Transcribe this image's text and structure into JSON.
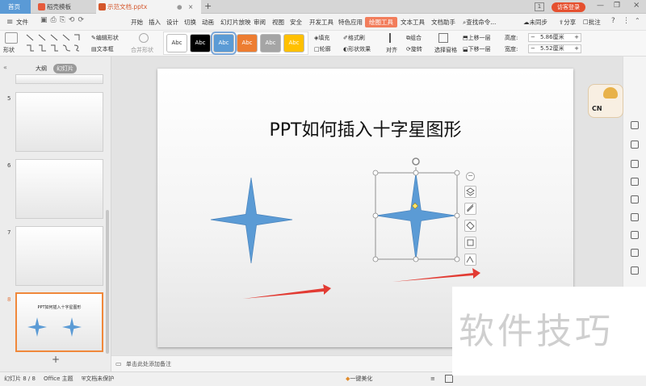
{
  "tabs": [
    {
      "label": "首页"
    },
    {
      "label": "稻壳模板"
    },
    {
      "label": "示范文档.pptx"
    }
  ],
  "title_right": {
    "login": "访客登录",
    "page_badge": "1"
  },
  "menu": {
    "file": "文件",
    "items": [
      "开始",
      "插入",
      "设计",
      "切换",
      "动画",
      "幻灯片放映",
      "审阅",
      "视图",
      "安全",
      "开发工具",
      "特色应用",
      "绘图工具",
      "文本工具",
      "文档助手"
    ],
    "active": "绘图工具",
    "search": "查找命令...",
    "sync": "未同步",
    "share": "分享",
    "comment": "批注"
  },
  "ribbon": {
    "shape": "形状",
    "edit_shape": "编辑形状",
    "textbox": "文本框",
    "merge_shape": "合并形状",
    "styles": [
      "Abc",
      "Abc",
      "Abc",
      "Abc",
      "Abc",
      "Abc"
    ],
    "style_colors": [
      "#ffffff",
      "#000000",
      "#5b9bd5",
      "#ed7d31",
      "#a5a5a5",
      "#ffc000"
    ],
    "fill": "填充",
    "format_brush": "格式刷",
    "outline": "轮廓",
    "shape_effect": "形状效果",
    "align": "对齐",
    "group": "组合",
    "rotate": "旋转",
    "select_pane": "选择窗格",
    "bring_forward": "上移一层",
    "send_backward": "下移一层",
    "height_label": "高度:",
    "height_value": "5.86厘米",
    "width_label": "宽度:",
    "width_value": "5.52厘米"
  },
  "panel": {
    "tab_outline": "大纲",
    "tab_slides": "幻灯片",
    "slide_numbers": [
      "5",
      "6",
      "7",
      "8"
    ],
    "thumb_title": "PPT如何插入十字星图形",
    "add": "+"
  },
  "slide": {
    "title": "PPT如何插入十字星图形"
  },
  "notes": {
    "placeholder": "单击此处添加备注"
  },
  "status": {
    "slide_count": "幻灯片 8 / 8",
    "theme": "Office 主题",
    "protect": "文档未保护",
    "beautify": "一键美化"
  },
  "watermark": {
    "text": "软件技巧"
  },
  "mascot": {
    "text": "CN"
  },
  "colors": {
    "star": "#5b9bd5",
    "arrow": "#e23b33",
    "accent": "#f27d5b",
    "selection": "#f0883b"
  },
  "float_tools": [
    "minus-icon",
    "layers-icon",
    "pen-icon",
    "fill-icon",
    "frame-icon",
    "alt-text-icon"
  ]
}
